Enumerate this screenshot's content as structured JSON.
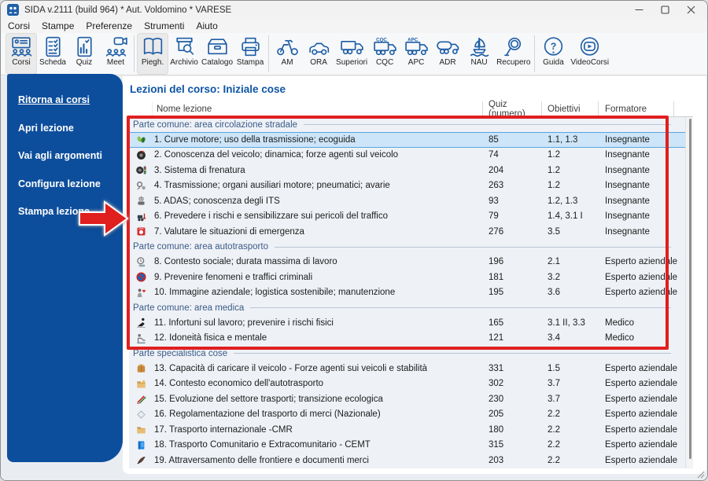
{
  "window": {
    "title": "SIDA v.2111 (build 964) * Aut. Voldomino * VARESE",
    "app_icon": "sida-logo-icon",
    "controls": [
      "minimize",
      "maximize",
      "close"
    ]
  },
  "menu": [
    {
      "label": "Corsi"
    },
    {
      "label": "Stampe"
    },
    {
      "label": "Preferenze"
    },
    {
      "label": "Strumenti"
    },
    {
      "label": "Aiuto"
    }
  ],
  "toolbar": {
    "groups": [
      {
        "items": [
          {
            "label": "Corsi",
            "icon": "courses-presentation-icon",
            "pressed": true
          },
          {
            "label": "Scheda",
            "icon": "sheet-checklist-icon",
            "pressed": false
          },
          {
            "label": "Quiz",
            "icon": "quiz-stats-icon",
            "pressed": false
          },
          {
            "label": "Meet",
            "icon": "meet-video-icon",
            "pressed": false
          }
        ]
      },
      {
        "items": [
          {
            "label": "Piegh.",
            "icon": "leaflet-book-icon",
            "pressed": true
          },
          {
            "label": "Archivio",
            "icon": "archive-search-icon",
            "pressed": false
          },
          {
            "label": "Catalogo",
            "icon": "catalog-drawer-icon",
            "pressed": false
          },
          {
            "label": "Stampa",
            "icon": "printer-icon",
            "pressed": false
          }
        ]
      },
      {
        "items": [
          {
            "label": "AM",
            "icon": "moped-icon",
            "pressed": false
          },
          {
            "label": "ORA",
            "icon": "car-icon",
            "pressed": false
          },
          {
            "label": "Superiori",
            "icon": "truck-icon",
            "pressed": false
          },
          {
            "label": "CQC",
            "icon": "truck-cqc-icon",
            "pressed": false
          },
          {
            "label": "APC",
            "icon": "truck-apc-icon",
            "pressed": false
          },
          {
            "label": "ADR",
            "icon": "tanker-truck-icon",
            "pressed": false
          },
          {
            "label": "NAU",
            "icon": "sailboat-icon",
            "pressed": false
          },
          {
            "label": "Recupero",
            "icon": "magnifier-icon",
            "pressed": false
          }
        ]
      },
      {
        "items": [
          {
            "label": "Guida",
            "icon": "help-circle-icon",
            "pressed": false
          },
          {
            "label": "VideoCorsi",
            "icon": "video-play-icon",
            "pressed": false
          }
        ]
      }
    ]
  },
  "sidebar": {
    "items": [
      {
        "label": "Ritorna ai corsi",
        "underlined": true
      },
      {
        "label": "Apri lezione",
        "underlined": false
      },
      {
        "label": "Vai agli argomenti",
        "underlined": false
      },
      {
        "label": "Configura lezione",
        "underlined": false
      },
      {
        "label": "Stampa lezione",
        "underlined": false
      }
    ]
  },
  "main": {
    "title": "Lezioni del corso: Iniziale cose",
    "table": {
      "columns": [
        "Nome lezione",
        "Quiz (numero)",
        "Obiettivi",
        "Formatore"
      ],
      "rows": [
        {
          "type": "group",
          "label": "Parte comune: area circolazione stradale"
        },
        {
          "type": "lesson",
          "icon": "eco-leaves-icon",
          "name": "1. Curve motore; uso della trasmissione; ecoguida",
          "quiz": "85",
          "obiettivi": "1.1, 1.3",
          "formatore": "Insegnante",
          "selected": true
        },
        {
          "type": "lesson",
          "icon": "steering-wheel-icon",
          "name": "2. Conoscenza del veicolo; dinamica; forze agenti sul veicolo",
          "quiz": "74",
          "obiettivi": "1.2",
          "formatore": "Insegnante"
        },
        {
          "type": "lesson",
          "icon": "tire-brakes-icon",
          "name": "3. Sistema di frenatura",
          "quiz": "204",
          "obiettivi": "1.2",
          "formatore": "Insegnante"
        },
        {
          "type": "lesson",
          "icon": "transmission-gears-icon",
          "name": "4. Trasmissione; organi ausiliari motore; pneumatici; avarie",
          "quiz": "263",
          "obiettivi": "1.2",
          "formatore": "Insegnante"
        },
        {
          "type": "lesson",
          "icon": "adas-robot-icon",
          "name": "5. ADAS; conoscenza degli ITS",
          "quiz": "93",
          "obiettivi": "1.2, 1.3",
          "formatore": "Insegnante"
        },
        {
          "type": "lesson",
          "icon": "risk-vehicle-icon",
          "name": "6. Prevedere i rischi e sensibilizzare sui pericoli del traffico",
          "quiz": "79",
          "obiettivi": "1.4, 3.1 I",
          "formatore": "Insegnante"
        },
        {
          "type": "lesson",
          "icon": "emergency-sign-icon",
          "name": "7. Valutare le situazioni di emergenza",
          "quiz": "276",
          "obiettivi": "3.5",
          "formatore": "Insegnante"
        },
        {
          "type": "group",
          "label": "Parte comune: area autotrasporto"
        },
        {
          "type": "lesson",
          "icon": "work-clock-icon",
          "name": "8. Contesto sociale; durata massima di lavoro",
          "quiz": "196",
          "obiettivi": "2.1",
          "formatore": "Esperto aziendale"
        },
        {
          "type": "lesson",
          "icon": "no-entry-icon",
          "name": "9. Prevenire fenomeni e traffici criminali",
          "quiz": "181",
          "obiettivi": "3.2",
          "formatore": "Esperto aziendale"
        },
        {
          "type": "lesson",
          "icon": "company-heart-icon",
          "name": "10. Immagine aziendale; logistica sostenibile; manutenzione",
          "quiz": "195",
          "obiettivi": "3.6",
          "formatore": "Esperto aziendale"
        },
        {
          "type": "group",
          "label": "Parte comune: area medica"
        },
        {
          "type": "lesson",
          "icon": "injury-fall-icon",
          "name": "11. Infortuni sul lavoro; prevenire i rischi fisici",
          "quiz": "165",
          "obiettivi": "3.1 II, 3.3",
          "formatore": "Medico"
        },
        {
          "type": "lesson",
          "icon": "fitness-person-icon",
          "name": "12. Idoneità fisica e mentale",
          "quiz": "121",
          "obiettivi": "3.4",
          "formatore": "Medico"
        },
        {
          "type": "group",
          "label": "Parte specialistica cose"
        },
        {
          "type": "lesson",
          "icon": "cargo-box-icon",
          "name": "13. Capacità di caricare il veicolo - Forze agenti sui veicoli e stabilità",
          "quiz": "331",
          "obiettivi": "1.5",
          "formatore": "Esperto aziendale"
        },
        {
          "type": "lesson",
          "icon": "economy-folder-icon",
          "name": "14. Contesto economico dell'autotrasporto",
          "quiz": "302",
          "obiettivi": "3.7",
          "formatore": "Esperto aziendale"
        },
        {
          "type": "lesson",
          "icon": "eco-pens-icon",
          "name": "15. Evoluzione del settore trasporti; transizione ecologica",
          "quiz": "230",
          "obiettivi": "3.7",
          "formatore": "Esperto aziendale"
        },
        {
          "type": "lesson",
          "icon": "diamond-sign-icon",
          "name": "16. Regolamentazione del trasporto di merci (Nazionale)",
          "quiz": "205",
          "obiettivi": "2.2",
          "formatore": "Esperto aziendale"
        },
        {
          "type": "lesson",
          "icon": "intl-folder-icon",
          "name": "17. Trasporto internazionale -CMR",
          "quiz": "180",
          "obiettivi": "2.2",
          "formatore": "Esperto aziendale"
        },
        {
          "type": "lesson",
          "icon": "eu-book-icon",
          "name": "18. Trasporto Comunitario e Extracomunitario - CEMT",
          "quiz": "315",
          "obiettivi": "2.2",
          "formatore": "Esperto aziendale"
        },
        {
          "type": "lesson",
          "icon": "customs-quill-icon",
          "name": "19. Attraversamento delle frontiere e documenti merci",
          "quiz": "203",
          "obiettivi": "2.2",
          "formatore": "Esperto aziendale"
        }
      ]
    }
  },
  "annotations": {
    "highlight_rectangle": "red-rectangle-annotation",
    "arrow": "red-arrow-annotation"
  },
  "colors": {
    "sidebar_blue": "#0d4e9c",
    "title_blue": "#0d55a5",
    "toolbar_icon_blue": "#1e5ea6",
    "annotation_red": "#e01f1f",
    "selected_row_bg": "#cde5f8",
    "selected_row_border": "#58a6e0",
    "table_body_bg": "#eef1f6",
    "group_text": "#3b5c88"
  }
}
